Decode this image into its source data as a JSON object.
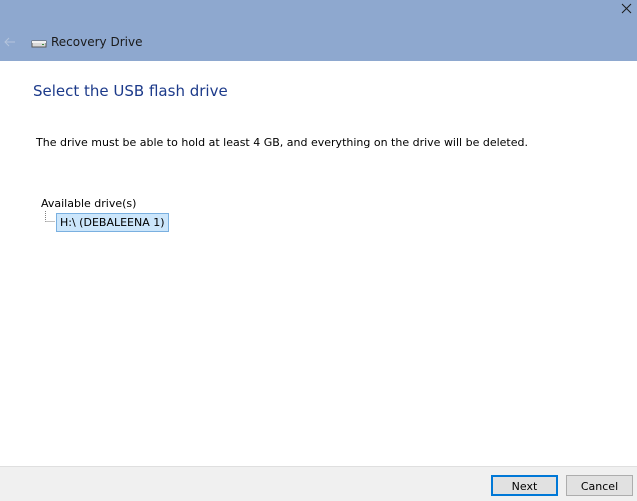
{
  "window": {
    "title": "Recovery Drive",
    "titlebar_color": "#8ea8cf"
  },
  "icons": {
    "close": "close-icon",
    "back": "back-arrow-icon",
    "app": "drive-icon"
  },
  "page": {
    "heading": "Select the USB flash drive",
    "description": "The drive must be able to hold at least 4 GB, and everything on the drive will be deleted.",
    "drives_label": "Available drive(s)",
    "drives": [
      {
        "label": "H:\\ (DEBALEENA 1)",
        "selected": true
      }
    ]
  },
  "footer": {
    "next_label": "Next",
    "cancel_label": "Cancel"
  }
}
